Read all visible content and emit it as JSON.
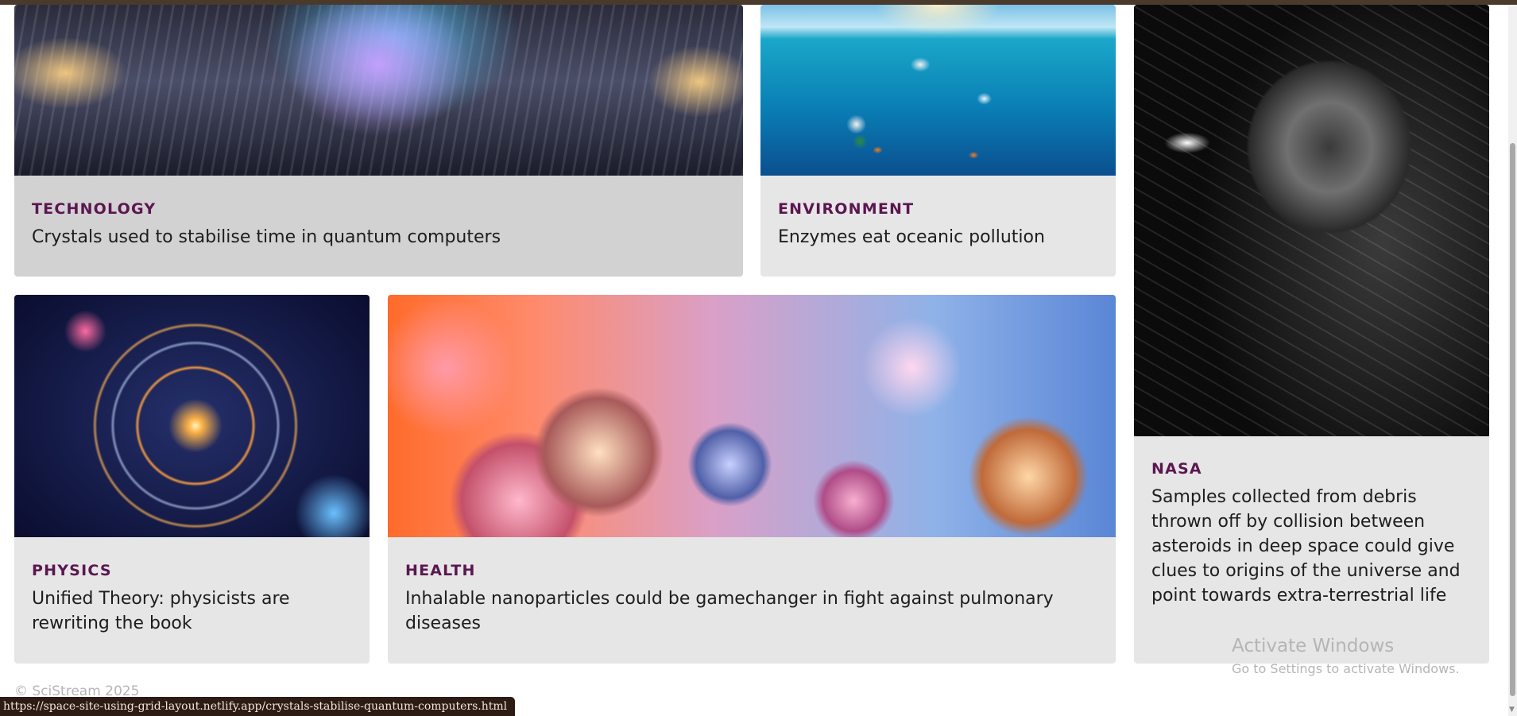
{
  "cards": [
    {
      "category": "TECHNOLOGY",
      "headline": "Crystals used to stabilise time in quantum computers"
    },
    {
      "category": "ENVIRONMENT",
      "headline": "Enzymes eat oceanic pollution"
    },
    {
      "category": "NASA",
      "headline": "Samples collected from debris thrown off by collision between asteroids in deep space could give clues to origins of the universe and point towards extra-terrestrial life"
    },
    {
      "category": "PHYSICS",
      "headline": "Unified Theory: physicists are rewriting the book"
    },
    {
      "category": "HEALTH",
      "headline": "Inhalable nanoparticles could be gamechanger in fight against pulmonary diseases"
    }
  ],
  "footer": {
    "copyright": "© SciStream 2025"
  },
  "status_bar": {
    "url": "https://space-site-using-grid-layout.netlify.app/crystals-stabilise-quantum-computers.html"
  },
  "watermark": {
    "title": "Activate Windows",
    "subtitle": "Go to Settings to activate Windows."
  }
}
